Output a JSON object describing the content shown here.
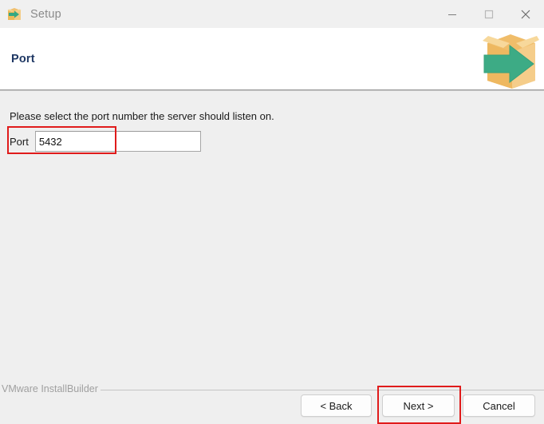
{
  "window": {
    "title": "Setup",
    "icon": "installer-box-arrow-icon",
    "controls": {
      "minimize": "minimize-icon",
      "maximize": "maximize-icon",
      "close": "close-icon"
    }
  },
  "header": {
    "title": "Port",
    "art": "installer-box-arrow-graphic",
    "title_color": "#1f3864"
  },
  "main": {
    "instruction": "Please select the port number the server should listen on.",
    "port_field": {
      "label": "Port",
      "value": "5432",
      "placeholder": ""
    }
  },
  "annotations": {
    "accent_color": "#e01b1b",
    "boxes": [
      {
        "name": "port-field-highlight",
        "target": "port-field"
      },
      {
        "name": "next-button-highlight",
        "target": "next-button"
      }
    ]
  },
  "footer": {
    "brand": "VMware InstallBuilder",
    "buttons": {
      "back": "< Back",
      "next": "Next >",
      "cancel": "Cancel"
    }
  }
}
